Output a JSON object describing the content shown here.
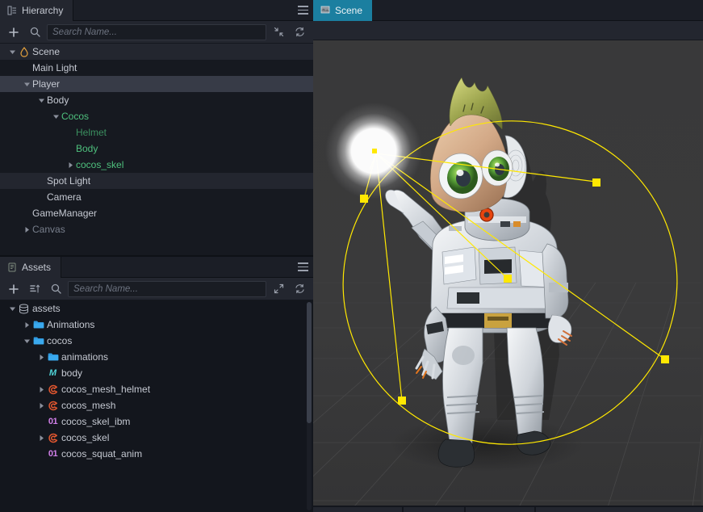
{
  "hierarchy_panel": {
    "tab_label": "Hierarchy",
    "tab_icon": "hierarchy-icon",
    "menu_icon": "hamburger-menu-icon",
    "toolbar": {
      "add_icon": "plus-icon",
      "search_icon": "search-icon",
      "collapse_icon": "collapse-all-icon",
      "refresh_icon": "refresh-icon"
    },
    "search": {
      "value": "",
      "placeholder": "Search Name..."
    },
    "nodes": [
      {
        "label": "Scene",
        "depth": 0,
        "arrow": "down",
        "icon": "scene-flame-icon",
        "style": "normal",
        "bg": "alt"
      },
      {
        "label": "Main Light",
        "depth": 1,
        "arrow": "none",
        "icon": "none",
        "style": "normal",
        "bg": "none"
      },
      {
        "label": "Player",
        "depth": 1,
        "arrow": "down",
        "icon": "none",
        "style": "normal",
        "bg": "sel"
      },
      {
        "label": "Body",
        "depth": 2,
        "arrow": "down",
        "icon": "none",
        "style": "normal",
        "bg": "none"
      },
      {
        "label": "Cocos",
        "depth": 3,
        "arrow": "down",
        "icon": "none",
        "style": "green",
        "bg": "none"
      },
      {
        "label": "Helmet",
        "depth": 4,
        "arrow": "none",
        "icon": "none",
        "style": "green-dim",
        "bg": "none"
      },
      {
        "label": "Body",
        "depth": 4,
        "arrow": "none",
        "icon": "none",
        "style": "green",
        "bg": "none"
      },
      {
        "label": "cocos_skel",
        "depth": 4,
        "arrow": "right",
        "icon": "none",
        "style": "green",
        "bg": "none"
      },
      {
        "label": "Spot Light",
        "depth": 2,
        "arrow": "none",
        "icon": "none",
        "style": "normal",
        "bg": "alt"
      },
      {
        "label": "Camera",
        "depth": 2,
        "arrow": "none",
        "icon": "none",
        "style": "normal",
        "bg": "none"
      },
      {
        "label": "GameManager",
        "depth": 1,
        "arrow": "none",
        "icon": "none",
        "style": "normal",
        "bg": "none"
      },
      {
        "label": "Canvas",
        "depth": 1,
        "arrow": "right",
        "icon": "none",
        "style": "dim",
        "bg": "none"
      }
    ]
  },
  "assets_panel": {
    "tab_label": "Assets",
    "tab_icon": "assets-icon",
    "menu_icon": "hamburger-menu-icon",
    "toolbar": {
      "add_icon": "plus-icon",
      "sort_icon": "sort-icon",
      "search_icon": "search-icon",
      "expand_icon": "expand-icon",
      "refresh_icon": "refresh-icon"
    },
    "search": {
      "value": "",
      "placeholder": "Search Name..."
    },
    "nodes": [
      {
        "label": "assets",
        "depth": 0,
        "arrow": "down",
        "icon": "database-icon"
      },
      {
        "label": "Animations",
        "depth": 1,
        "arrow": "right",
        "icon": "folder-icon"
      },
      {
        "label": "cocos",
        "depth": 1,
        "arrow": "down",
        "icon": "folder-icon"
      },
      {
        "label": "animations",
        "depth": 2,
        "arrow": "right",
        "icon": "folder-icon"
      },
      {
        "label": "body",
        "depth": 2,
        "arrow": "none",
        "icon": "material-m-icon"
      },
      {
        "label": "cocos_mesh_helmet",
        "depth": 2,
        "arrow": "right",
        "icon": "cocos-g-icon"
      },
      {
        "label": "cocos_mesh",
        "depth": 2,
        "arrow": "right",
        "icon": "cocos-g-icon"
      },
      {
        "label": "cocos_skel_ibm",
        "depth": 2,
        "arrow": "none",
        "icon": "binary-01-icon"
      },
      {
        "label": "cocos_skel",
        "depth": 2,
        "arrow": "right",
        "icon": "cocos-g-icon"
      },
      {
        "label": "cocos_squat_anim",
        "depth": 2,
        "arrow": "none",
        "icon": "binary-01-icon"
      }
    ]
  },
  "scene_panel": {
    "tab_label": "Scene",
    "tab_icon": "scene-view-icon",
    "selection": "Spot Light",
    "gizmo": {
      "type": "spot-light-gizmo",
      "color": "#ffe800",
      "handle_count": 4
    },
    "content": {
      "model": "cocos-astronaut-character",
      "light": "spot-light-source"
    }
  },
  "colors": {
    "accent_tab": "#1b7fa0",
    "gizmo_yellow": "#ffe800",
    "tree_green": "#4ec07d",
    "panel_bg": "#23262f",
    "tree_bg": "#161920"
  }
}
